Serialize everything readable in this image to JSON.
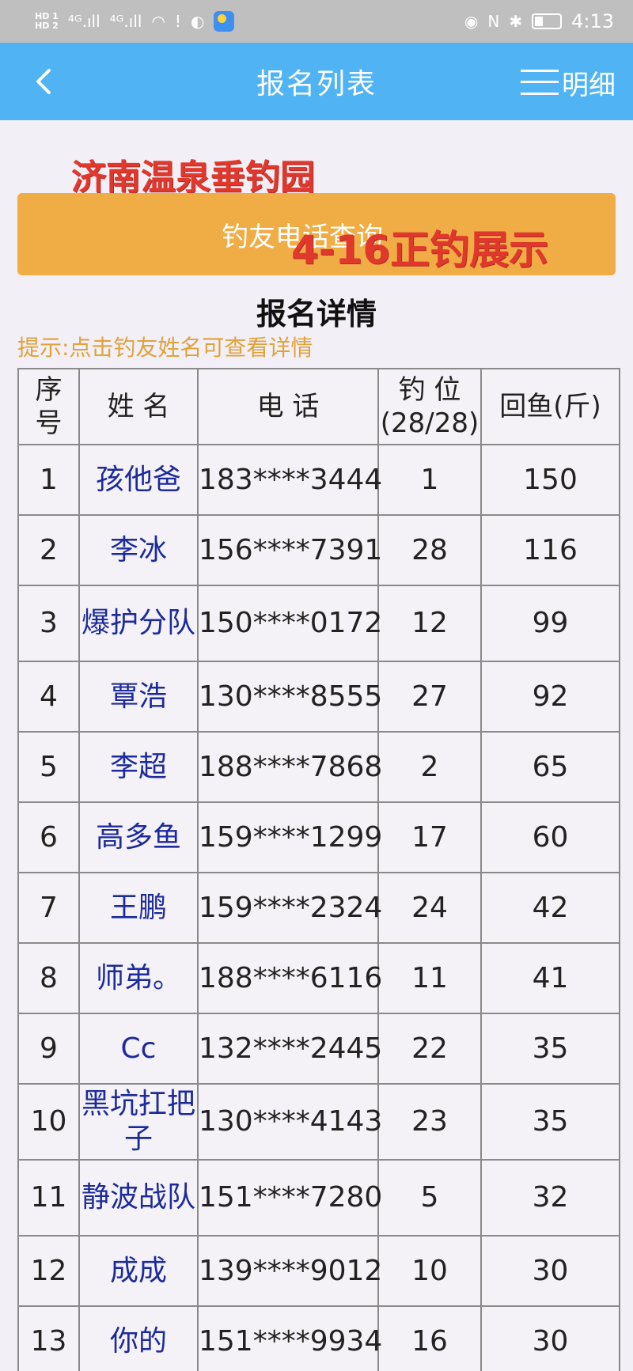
{
  "statusbar": {
    "hd_top": "HD 1",
    "hd_bottom": "HD 2",
    "signal1": "⁴ᴳ.ıll",
    "signal2": "⁴ᴳ.ıll",
    "wifi": "◠",
    "alert": "!",
    "chat": "◐",
    "eye": "◉",
    "nfc": "N",
    "bluetooth": "✱",
    "time": "4:13"
  },
  "header": {
    "title": "报名列表",
    "detail_label": "明细"
  },
  "venue_name": "济南温泉垂钓园",
  "query_button": "钓友电话查询",
  "overlay_caption": "4-16正钓展示",
  "section_title": "报名详情",
  "hint": "提示:点击钓友姓名可查看详情",
  "table": {
    "headers": {
      "no": "序号",
      "name": "姓 名",
      "phone": "电 话",
      "seat": "钓 位",
      "seat_count": "(28/28)",
      "fish": "回鱼(斤)"
    },
    "rows": [
      {
        "no": "1",
        "name": "孩他爸",
        "phone": "183****3444",
        "seat": "1",
        "fish": "150"
      },
      {
        "no": "2",
        "name": "李冰",
        "phone": "156****7391",
        "seat": "28",
        "fish": "116"
      },
      {
        "no": "3",
        "name": "爆护分队",
        "phone": "150****0172",
        "seat": "12",
        "fish": "99"
      },
      {
        "no": "4",
        "name": "覃浩",
        "phone": "130****8555",
        "seat": "27",
        "fish": "92"
      },
      {
        "no": "5",
        "name": "李超",
        "phone": "188****7868",
        "seat": "2",
        "fish": "65"
      },
      {
        "no": "6",
        "name": "高多鱼",
        "phone": "159****1299",
        "seat": "17",
        "fish": "60"
      },
      {
        "no": "7",
        "name": "王鹏",
        "phone": "159****2324",
        "seat": "24",
        "fish": "42"
      },
      {
        "no": "8",
        "name": "师弟。",
        "phone": "188****6116",
        "seat": "11",
        "fish": "41"
      },
      {
        "no": "9",
        "name": "Cc",
        "phone": "132****2445",
        "seat": "22",
        "fish": "35"
      },
      {
        "no": "10",
        "name": "黑坑扛把子",
        "phone": "130****4143",
        "seat": "23",
        "fish": "35"
      },
      {
        "no": "11",
        "name": "静波战队",
        "phone": "151****7280",
        "seat": "5",
        "fish": "32"
      },
      {
        "no": "12",
        "name": "成成",
        "phone": "139****9012",
        "seat": "10",
        "fish": "30"
      },
      {
        "no": "13",
        "name": "你的",
        "phone": "151****9934",
        "seat": "16",
        "fish": "30"
      }
    ]
  },
  "colors": {
    "header_bg": "#50b4f4",
    "button_bg": "#f0ad45",
    "hint_color": "#e0a23a",
    "overlay_red": "#e0382d",
    "name_link": "#1c2a9c"
  }
}
